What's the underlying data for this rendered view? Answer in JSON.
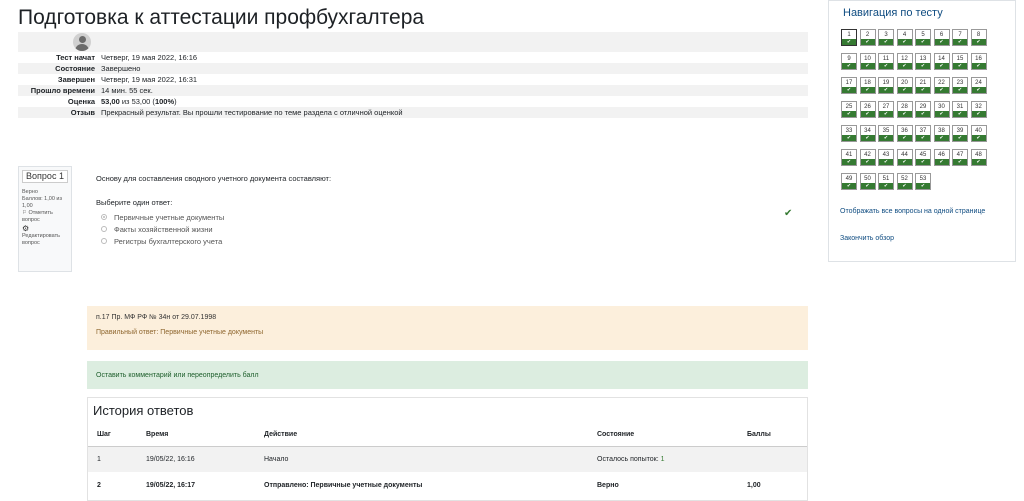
{
  "page": {
    "title": "Подготовка к аттестации профбухгалтера"
  },
  "summary": {
    "rows": [
      {
        "label": "Тест начат",
        "value": "Четверг, 19 мая 2022, 16:16"
      },
      {
        "label": "Состояние",
        "value": "Завершено"
      },
      {
        "label": "Завершен",
        "value": "Четверг, 19 мая 2022, 16:31"
      },
      {
        "label": "Прошло времени",
        "value": "14 мин. 55 сек."
      },
      {
        "label": "Оценка",
        "value_bold": "53,00",
        "value_mid": " из 53,00 (",
        "value_pct": "100%",
        "value_end": ")"
      },
      {
        "label": "Отзыв",
        "value": "Прекрасный результат. Вы прошли тестирование по теме раздела с отличной оценкой"
      }
    ]
  },
  "question": {
    "number_label": "Вопрос 1",
    "status": "Верно",
    "score": "Баллов: 1,00 из 1,00",
    "flag": "⚐ Отметить вопрос",
    "edit": "Редактировать вопрос",
    "text": "Основу для составления сводного учетного документа составляют:",
    "prompt": "Выберите один ответ:",
    "answers": [
      {
        "label": "Первичные учетные документы",
        "selected": true
      },
      {
        "label": "Факты хозяйственной жизни",
        "selected": false
      },
      {
        "label": "Регистры бухгалтерского учета",
        "selected": false
      }
    ],
    "correct_icon": "check-icon"
  },
  "feedback": {
    "general": "п.17 Пр. МФ РФ № 34н от 29.07.1998",
    "right_answer": "Правильный ответ: Первичные учетные документы"
  },
  "comment": {
    "label": "Оставить комментарий или переопределить балл"
  },
  "history": {
    "title": "История ответов",
    "headers": [
      "Шаг",
      "Время",
      "Действие",
      "Состояние",
      "Баллы"
    ],
    "rows": [
      {
        "step": "1",
        "time": "19/05/22, 16:16",
        "action": "Начало",
        "state_prefix": "Осталось попыток: ",
        "state_count": "1",
        "score": ""
      },
      {
        "step": "2",
        "time": "19/05/22, 16:17",
        "action": "Отправлено: Первичные учетные документы",
        "state": "Верно",
        "score": "1,00"
      }
    ]
  },
  "navigation": {
    "title": "Навигация по тесту",
    "question_count": 53,
    "current": 1,
    "links": {
      "show_all": "Отображать все вопросы на одной странице",
      "finish": "Закончить обзор"
    }
  }
}
